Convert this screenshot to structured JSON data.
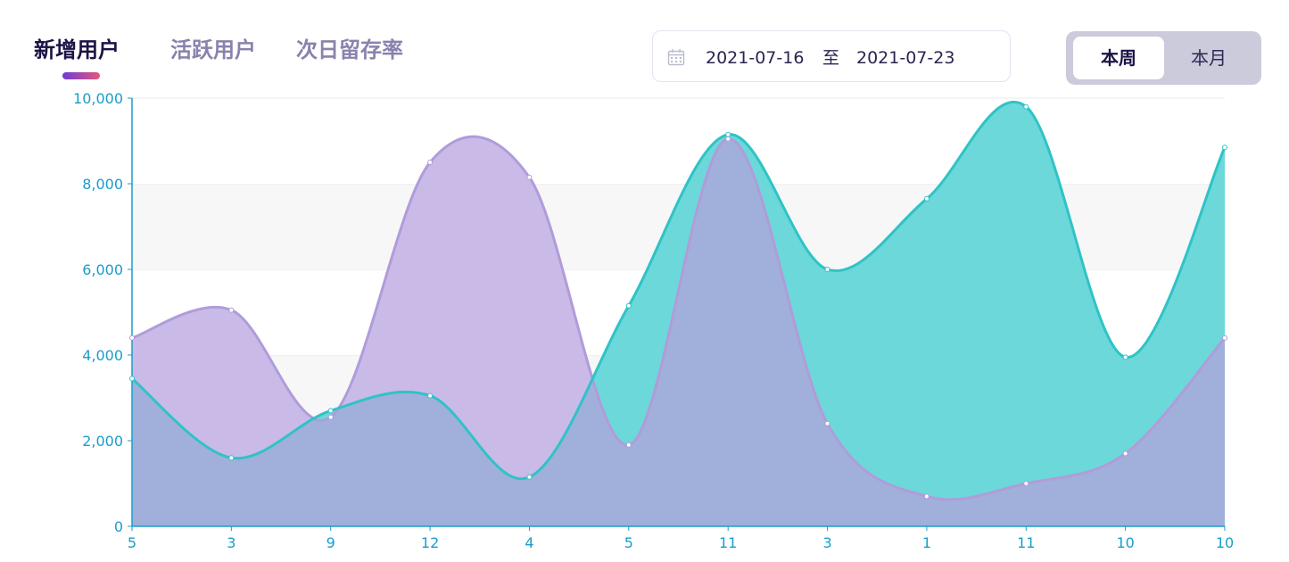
{
  "tabs": [
    {
      "label": "新增用户",
      "active": true
    },
    {
      "label": "活跃用户",
      "active": false
    },
    {
      "label": "次日留存率",
      "active": false
    }
  ],
  "date_range": {
    "icon": "calendar-icon",
    "start": "2021-07-16",
    "separator": "至",
    "end": "2021-07-23"
  },
  "period": {
    "options": [
      "本周",
      "本月"
    ],
    "selected": "本周"
  },
  "colors": {
    "series_purple_line": "#b09cda",
    "series_purple_fill": "#c4b2e5",
    "series_teal_line": "#2fc3c6",
    "series_teal_fill": "#5fd5d6",
    "overlap_fill": "#a0b0da",
    "axis": "#1a9dc8"
  },
  "chart_data": {
    "type": "area",
    "categories": [
      "5",
      "3",
      "9",
      "12",
      "4",
      "5",
      "11",
      "3",
      "1",
      "11",
      "10",
      "10"
    ],
    "ylim": [
      0,
      10000
    ],
    "yticks": [
      "0",
      "2,000",
      "4,000",
      "6,000",
      "8,000",
      "10,000"
    ],
    "grid": "alternating horizontal bands",
    "legend": "none",
    "series": [
      {
        "values": [
          4400,
          5050,
          2550,
          8500,
          8150,
          1900,
          9050,
          2400,
          700,
          1000,
          1700,
          4400
        ]
      },
      {
        "values": [
          3450,
          1600,
          2700,
          3050,
          1150,
          5150,
          9150,
          6000,
          7650,
          9800,
          3950,
          8850
        ]
      }
    ]
  }
}
